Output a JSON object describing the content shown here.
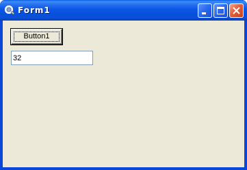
{
  "window": {
    "title": "Form1",
    "controls": {
      "minimize_icon": "minimize-icon",
      "maximize_icon": "maximize-icon",
      "close_icon": "close-icon"
    }
  },
  "form": {
    "button_label": "Button1",
    "textbox_value": "32"
  },
  "colors": {
    "titlebar": "#0a54de",
    "client_background": "#ece9d8",
    "close_button": "#e0603c"
  }
}
